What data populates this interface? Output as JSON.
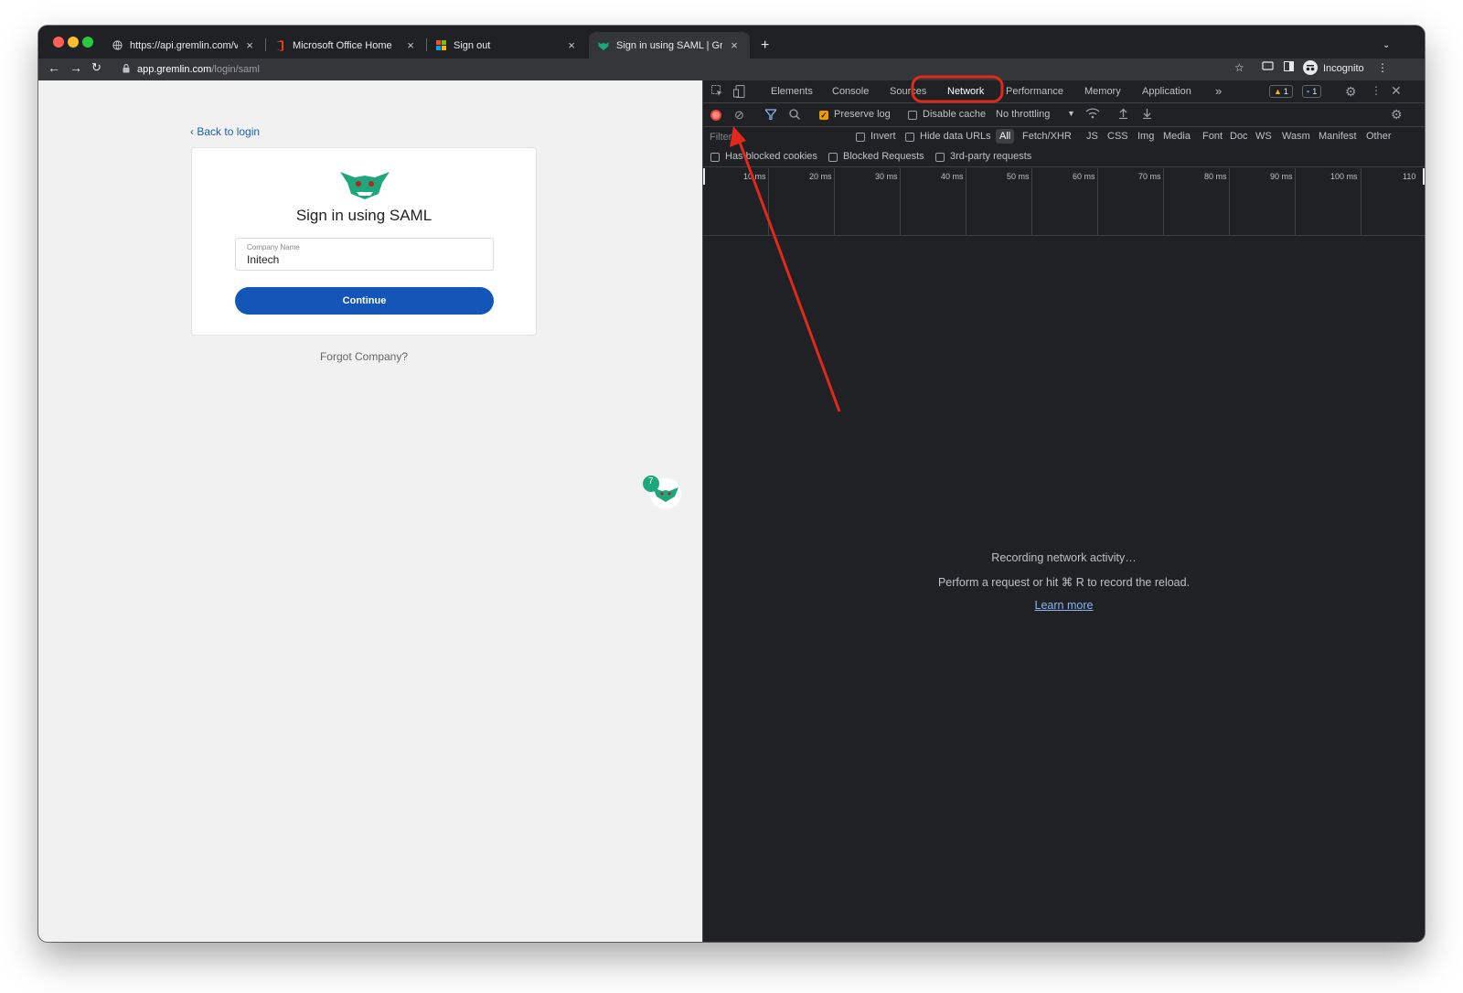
{
  "browser": {
    "tabs": [
      {
        "title": "https://api.gremlin.com/v1/users",
        "favicon": "globe-icon"
      },
      {
        "title": "Microsoft Office Home",
        "favicon": "office-icon"
      },
      {
        "title": "Sign out",
        "favicon": "microsoft-icon"
      },
      {
        "title": "Sign in using SAML | Gremlin",
        "favicon": "gremlin-icon"
      }
    ],
    "new_tab_label": "+",
    "address": {
      "host": "app.gremlin.com",
      "path": "/login/saml"
    },
    "profile_label": "Incognito"
  },
  "page": {
    "back_link": "Back to login",
    "heading": "Sign in using SAML",
    "company_field": {
      "label": "Company Name",
      "value": "Initech"
    },
    "continue_label": "Continue",
    "forgot_link": "Forgot Company?",
    "chat_badge_count": "7"
  },
  "devtools": {
    "tabs": [
      "Elements",
      "Console",
      "Sources",
      "Network",
      "Performance",
      "Memory",
      "Application"
    ],
    "selected_tab": "Network",
    "more_tabs": "»",
    "warning_count": "1",
    "message_count": "1",
    "preserve_log_label": "Preserve log",
    "disable_cache_label": "Disable cache",
    "throttling_label": "No throttling",
    "filter_placeholder": "Filter",
    "invert_label": "Invert",
    "hide_data_urls_label": "Hide data URLs",
    "type_filters": [
      "All",
      "Fetch/XHR",
      "JS",
      "CSS",
      "Img",
      "Media",
      "Font",
      "Doc",
      "WS",
      "Wasm",
      "Manifest",
      "Other"
    ],
    "has_blocked_cookies_label": "Has blocked cookies",
    "blocked_requests_label": "Blocked Requests",
    "third_party_label": "3rd-party requests",
    "timeline_ticks": [
      "10 ms",
      "20 ms",
      "30 ms",
      "40 ms",
      "50 ms",
      "60 ms",
      "70 ms",
      "80 ms",
      "90 ms",
      "100 ms",
      "110"
    ],
    "empty_title": "Recording network activity…",
    "empty_hint": "Perform a request or hit ⌘ R to record the reload.",
    "learn_more": "Learn more"
  },
  "annotation": {
    "highlight_color": "#e0291b"
  }
}
